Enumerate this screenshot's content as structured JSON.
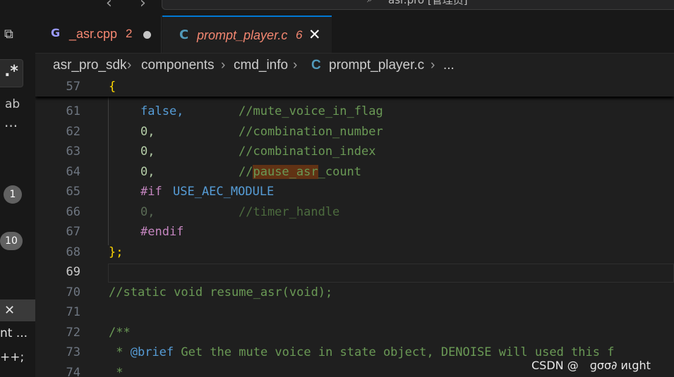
{
  "titlebar": {
    "back_arrow": "‹",
    "forward_arrow": "›",
    "command_center_text": "asr.pro [管理员]"
  },
  "activity_bar": {
    "badge_search": "1",
    "badge_scm": "10",
    "partial_text_1": "nt ...",
    "partial_text_2": "++;"
  },
  "tabs": [
    {
      "label": "_asr.cpp",
      "problems": "2",
      "icon_glyph": "G",
      "modified": true,
      "active": false
    },
    {
      "label": "prompt_player.c",
      "problems": "6",
      "icon_glyph": "C",
      "active": true
    }
  ],
  "breadcrumb": {
    "items": [
      "asr_pro_sdk",
      "components",
      "cmd_info",
      "prompt_player.c",
      "..."
    ],
    "file_icon_glyph": "C",
    "separator": "›"
  },
  "editor": {
    "sticky": {
      "line_number": "57",
      "text": "{"
    },
    "current_line": 69,
    "lines": [
      {
        "n": "61",
        "a": "false,",
        "b": "//mute_voice_in_flag"
      },
      {
        "n": "62",
        "a": "0,",
        "b": "//combination_number"
      },
      {
        "n": "63",
        "a": "0,",
        "b": "//combination_index"
      },
      {
        "n": "64",
        "a": "0,",
        "b1": "//",
        "b2": "pause_asr",
        "b3": "_count"
      },
      {
        "n": "65",
        "a": "#if",
        "b": "USE_AEC_MODULE"
      },
      {
        "n": "66",
        "a": "0,",
        "b": "//timer_handle"
      },
      {
        "n": "67",
        "a": "#endif"
      },
      {
        "n": "68",
        "a": "};"
      },
      {
        "n": "69"
      },
      {
        "n": "70",
        "a": "//static void resume_asr(void);"
      },
      {
        "n": "71"
      },
      {
        "n": "72",
        "a": "/**"
      },
      {
        "n": "73",
        "a": " * ",
        "b": "@brief",
        "c": " Get the mute voice in state object, DENOISE will used this f"
      },
      {
        "n": "74",
        "a": " *"
      }
    ]
  },
  "watermark": "CSDN @　ɡσσ∂ иιght",
  "colors": {
    "background": "#1f1f1f",
    "keyword": "#569cd6",
    "number": "#b5cea8",
    "comment": "#6a9955",
    "preprocessor": "#c586c0",
    "bracket": "#ffd700",
    "tab_error": "#f48771",
    "active_tab_border": "#0078d4"
  }
}
